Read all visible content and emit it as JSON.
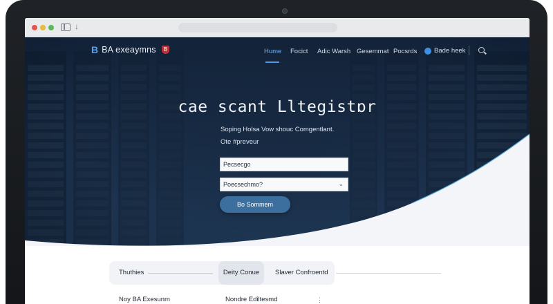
{
  "brand": {
    "mark": "B",
    "name": "BA exeaymns",
    "badge": "B"
  },
  "nav": {
    "items": [
      "Hume",
      "Focict",
      "Adic Warsh",
      "Gesemmat",
      "Pocsrds"
    ],
    "cta": "Bade heek"
  },
  "hero": {
    "headline": "cae scant Lltegistɒr",
    "subline": "Soping Holsa Vow shouc Comgentlant.",
    "subline2": "Ote #preveur",
    "field1_value": "Pecsecgo",
    "field2_value": "Poecsechmo?",
    "submit_label": "Bo Sommem"
  },
  "lower": {
    "tab1": "Thuthies",
    "tab2": "Deity Conue",
    "tab3": "Slaver Confroentd",
    "row_left": "Noy BA Exesunm",
    "row_right": "Nondre Ediltesmd",
    "row_right_icon": "⋮"
  },
  "colors": {
    "accent": "#4f9be6",
    "hero_bg": "#1a2f4a",
    "submit": "#3d6f9e",
    "badge": "#b8323a"
  }
}
